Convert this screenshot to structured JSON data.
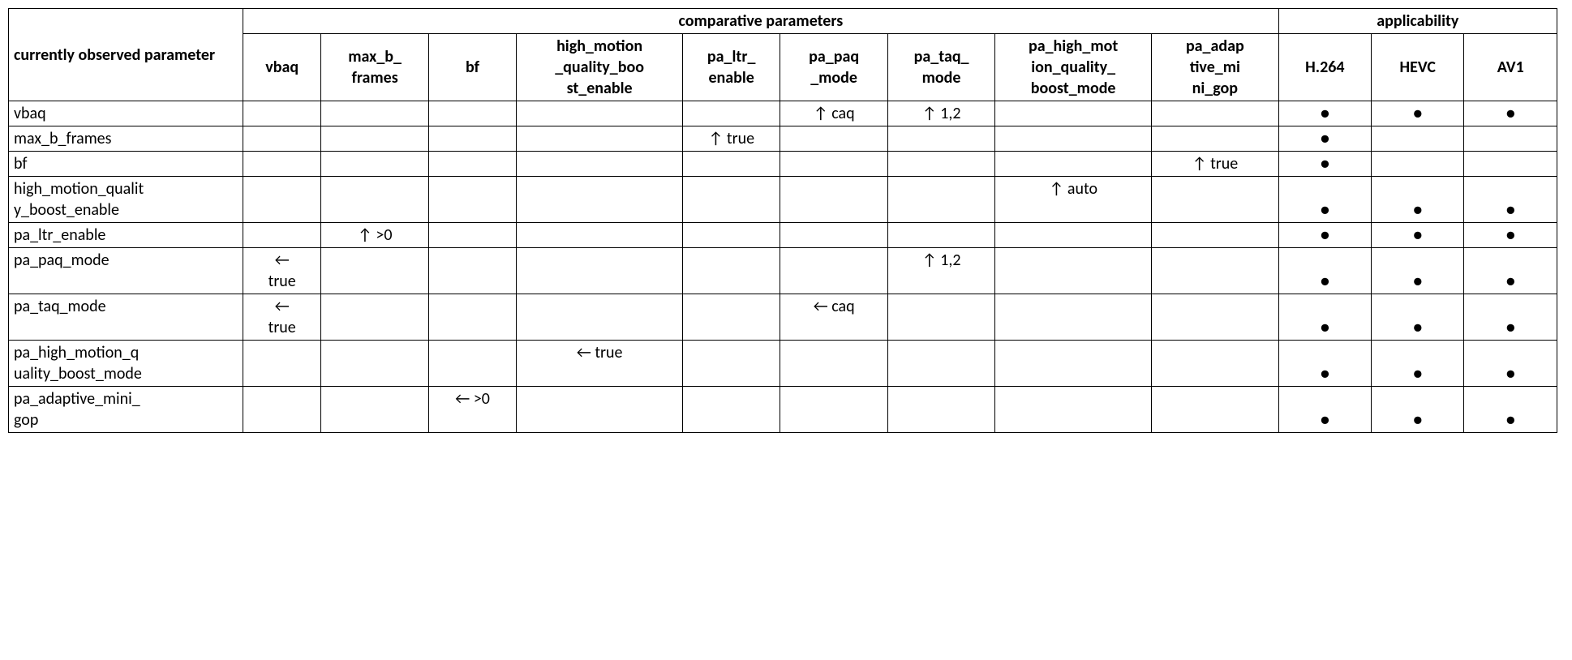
{
  "headers": {
    "row_param": "currently observed parameter",
    "comparative_group": "comparative parameters",
    "applicability_group": "applicability"
  },
  "comparative_cols": [
    "vbaq",
    "max_b_frames",
    "bf",
    "high_motion_quality_boost_enable",
    "pa_ltr_enable",
    "pa_paq_mode",
    "pa_taq_mode",
    "pa_high_motion_quality_boost_mode",
    "pa_adaptive_mini_gop"
  ],
  "applicability_cols": [
    "H.264",
    "HEVC",
    "AV1"
  ],
  "dot": "●",
  "rows": [
    {
      "label": "vbaq",
      "cmp": [
        "",
        "",
        "",
        "",
        "",
        "↑ caq",
        "↑ 1,2",
        "",
        ""
      ],
      "app": [
        true,
        true,
        true
      ]
    },
    {
      "label": "max_b_frames",
      "cmp": [
        "",
        "",
        "",
        "",
        "↑ true",
        "",
        "",
        "",
        ""
      ],
      "app": [
        true,
        false,
        false
      ]
    },
    {
      "label": "bf",
      "cmp": [
        "",
        "",
        "",
        "",
        "",
        "",
        "",
        "",
        "↑ true"
      ],
      "app": [
        true,
        false,
        false
      ]
    },
    {
      "label": "high_motion_quality_boost_enable",
      "cmp": [
        "",
        "",
        "",
        "",
        "",
        "",
        "",
        "↑ auto",
        ""
      ],
      "app": [
        true,
        true,
        true
      ]
    },
    {
      "label": "pa_ltr_enable",
      "cmp": [
        "",
        "↑ >0",
        "",
        "",
        "",
        "",
        "",
        "",
        ""
      ],
      "app": [
        true,
        true,
        true
      ]
    },
    {
      "label": "pa_paq_mode",
      "cmp": [
        "← true",
        "",
        "",
        "",
        "",
        "",
        "↑ 1,2",
        "",
        ""
      ],
      "app": [
        true,
        true,
        true
      ]
    },
    {
      "label": "pa_taq_mode",
      "cmp": [
        "← true",
        "",
        "",
        "",
        "",
        "← caq",
        "",
        "",
        ""
      ],
      "app": [
        true,
        true,
        true
      ]
    },
    {
      "label": "pa_high_motion_quality_boost_mode",
      "cmp": [
        "",
        "",
        "",
        "← true",
        "",
        "",
        "",
        "",
        ""
      ],
      "app": [
        true,
        true,
        true
      ]
    },
    {
      "label": "pa_adaptive_mini_gop",
      "cmp": [
        "",
        "",
        "← >0",
        "",
        "",
        "",
        "",
        "",
        ""
      ],
      "app": [
        true,
        true,
        true
      ]
    }
  ]
}
